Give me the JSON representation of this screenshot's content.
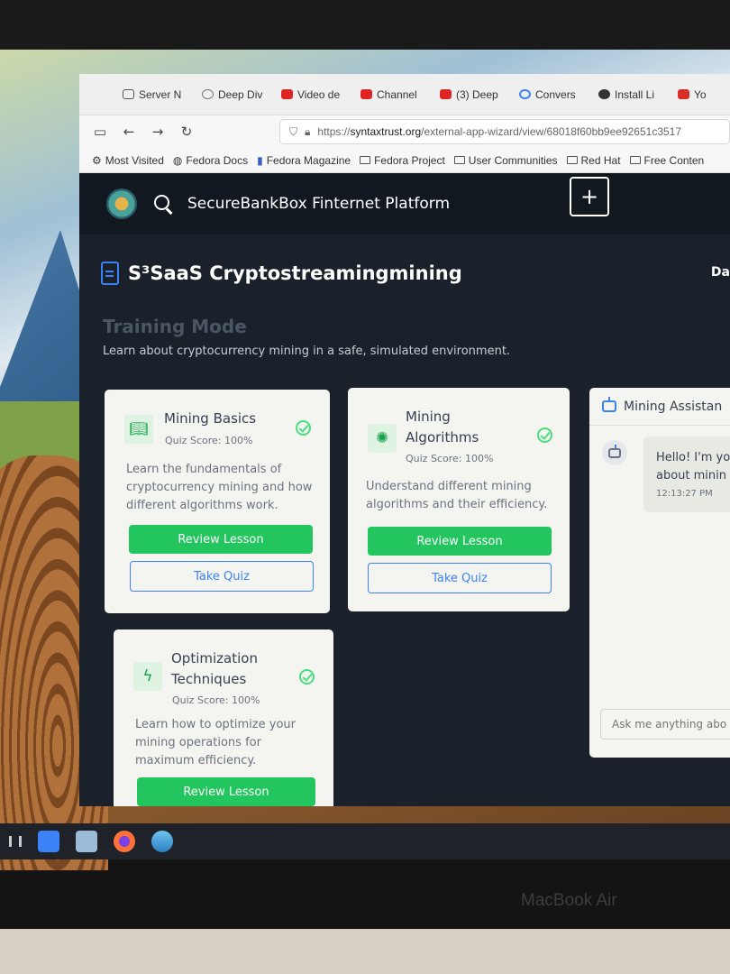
{
  "browser": {
    "tabs": [
      {
        "label": "Server N",
        "icon": "server-icon",
        "color": "#555555"
      },
      {
        "label": "Deep Div",
        "icon": "globe-icon",
        "color": "#777777"
      },
      {
        "label": "Video de",
        "icon": "youtube-icon",
        "color": "#e02424"
      },
      {
        "label": "Channel",
        "icon": "youtube-icon",
        "color": "#e02424"
      },
      {
        "label": "(3) Deep",
        "icon": "youtube-icon",
        "color": "#e02424"
      },
      {
        "label": "Convers",
        "icon": "loading-icon",
        "color": "#3b82f6"
      },
      {
        "label": "Install Li",
        "icon": "github-icon",
        "color": "#333333"
      },
      {
        "label": "Yo",
        "icon": "gmail-icon",
        "color": "#d93025"
      }
    ],
    "url_prefix": "https://",
    "url_host": "syntaxtrust.org",
    "url_path": "/external-app-wizard/view/68018f60bb9ee92651c3517",
    "bookmarks": [
      {
        "label": "Most Visited",
        "icon": "gear-icon"
      },
      {
        "label": "Fedora Docs",
        "icon": "globe-icon"
      },
      {
        "label": "Fedora Magazine",
        "icon": "bookmark-icon"
      },
      {
        "label": "Fedora Project",
        "icon": "folder-icon"
      },
      {
        "label": "User Communities",
        "icon": "folder-icon"
      },
      {
        "label": "Red Hat",
        "icon": "folder-icon"
      },
      {
        "label": "Free Conten",
        "icon": "folder-icon"
      }
    ]
  },
  "app": {
    "title": "SecureBankBox Finternet Platform",
    "add_label": "+",
    "page_title": "S³SaaS Cryptostreamingmining",
    "corner_text": "Da",
    "mode_title": "Training Mode",
    "mode_description": "Learn about cryptocurrency mining in a safe, simulated environment."
  },
  "cards": [
    {
      "title": "Mining Basics",
      "quiz_score": "Quiz Score: 100%",
      "description": "Learn the fundamentals of cryptocurrency mining and how different algorithms work.",
      "review_label": "Review Lesson",
      "quiz_label": "Take Quiz",
      "icon": "book-icon"
    },
    {
      "title": "Mining Algorithms",
      "quiz_score": "Quiz Score: 100%",
      "description": "Understand different mining algorithms and their efficiency.",
      "review_label": "Review Lesson",
      "quiz_label": "Take Quiz",
      "icon": "brain-icon"
    },
    {
      "title": "Optimization Techniques",
      "quiz_score": "Quiz Score: 100%",
      "description": "Learn how to optimize your mining operations for maximum efficiency.",
      "review_label": "Review Lesson",
      "icon": "bolt-icon"
    }
  ],
  "assistant": {
    "title": "Mining Assistan",
    "message_line1": "Hello! I'm yo",
    "message_line2": "about minin",
    "message_time": "12:13:27 PM",
    "input_placeholder": "Ask me anything abo"
  },
  "device": {
    "label": "MacBook Air"
  },
  "colors": {
    "accent_green": "#22c55e",
    "accent_blue": "#3b82f6",
    "app_background": "#1b212a"
  }
}
